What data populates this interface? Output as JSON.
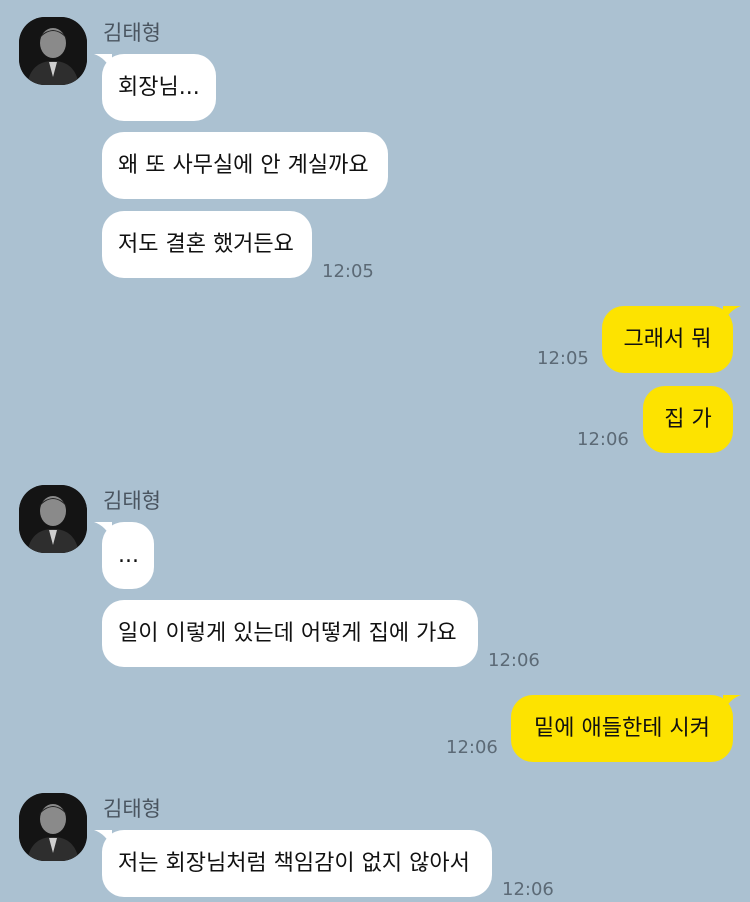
{
  "chat": {
    "groups": [
      {
        "sender": "김태형",
        "messages": [
          "회장님...",
          "왜 또 사무실에 안 계실까요",
          "저도 결혼 했거든요"
        ],
        "time": "12:05"
      },
      {
        "messages": [
          "그래서 뭐",
          "집 가"
        ],
        "times": [
          "12:05",
          "12:06"
        ]
      },
      {
        "sender": "김태형",
        "messages": [
          "...",
          "일이 이렇게 있는데 어떻게 집에 가요"
        ],
        "time": "12:06"
      },
      {
        "messages": [
          "밑에 애들한테 시켜"
        ],
        "time": "12:06"
      },
      {
        "sender": "김태형",
        "messages": [
          "저는 회장님처럼 책임감이 없지 않아서"
        ],
        "time": "12:06"
      }
    ]
  },
  "colors": {
    "background": "#abc1d1",
    "incoming_bubble": "#ffffff",
    "outgoing_bubble": "#fde300"
  },
  "icons": {
    "avatar": "profile-photo"
  }
}
